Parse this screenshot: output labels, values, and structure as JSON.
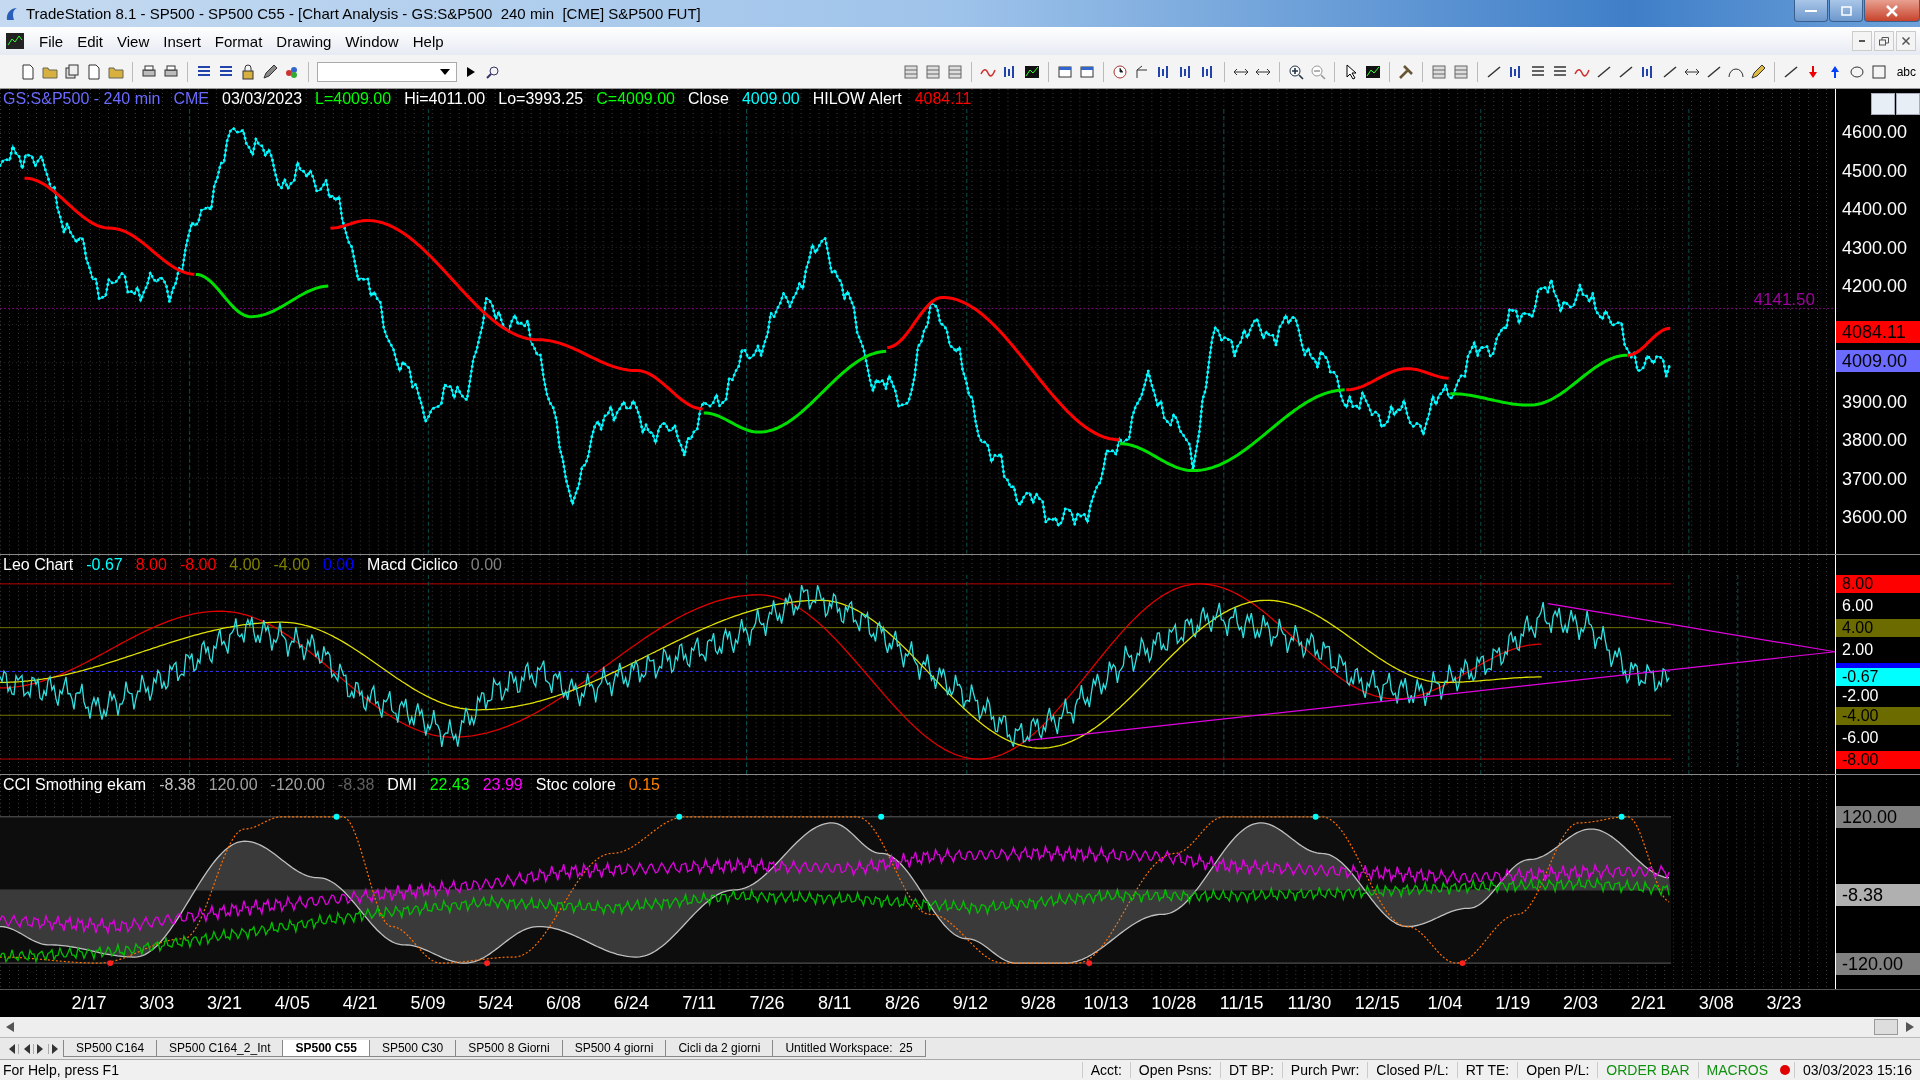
{
  "window": {
    "title": "TradeStation 8.1 - SP500 - SP500 C55 - [Chart Analysis - GS:S&P500  240 min  [CME] S&P500 FUT]"
  },
  "menu": [
    "File",
    "Edit",
    "View",
    "Insert",
    "Format",
    "Drawing",
    "Window",
    "Help"
  ],
  "toolbar": {
    "text_tool": "abc"
  },
  "price_panel": {
    "header": [
      {
        "text": "GS:S&P500 - 240 min",
        "color": "#6a6aff"
      },
      {
        "text": "CME",
        "color": "#6a6aff"
      },
      {
        "text": "03/03/2023",
        "color": "#ffffff"
      },
      {
        "text": "L=4009.00",
        "color": "#00ff00"
      },
      {
        "text": "Hi=4011.00",
        "color": "#ffffff"
      },
      {
        "text": "Lo=3993.25",
        "color": "#ffffff"
      },
      {
        "text": "C=4009.00",
        "color": "#00ff00"
      },
      {
        "text": "Close",
        "color": "#ffffff"
      },
      {
        "text": "4009.00",
        "color": "#00ffff"
      },
      {
        "text": "HILOW Alert",
        "color": "#ffffff"
      },
      {
        "text": "4084.11",
        "color": "#ff0000"
      }
    ],
    "level_label": "4141.50",
    "axis_ticks": [
      "4600.00",
      "4500.00",
      "4400.00",
      "4300.00",
      "4200.00",
      "3900.00",
      "3800.00",
      "3700.00",
      "3600.00"
    ],
    "markers": [
      {
        "text": "4084.11",
        "color": "#ff0000"
      },
      {
        "text": "4009.00",
        "color": "#6b6bff"
      }
    ]
  },
  "oscillator_panel": {
    "header": [
      {
        "text": "Leo Chart",
        "color": "#ffffff"
      },
      {
        "text": "-0.67",
        "color": "#00ffff"
      },
      {
        "text": "8.00",
        "color": "#ff0000"
      },
      {
        "text": "-8.00",
        "color": "#ff0000"
      },
      {
        "text": "4.00",
        "color": "#808000"
      },
      {
        "text": "-4.00",
        "color": "#808000"
      },
      {
        "text": "0.00",
        "color": "#0000ff"
      },
      {
        "text": "Macd Ciclico",
        "color": "#ffffff"
      },
      {
        "text": "0.00",
        "color": "#808080"
      }
    ],
    "axis_ticks": [
      "6.00",
      "2.00",
      "-2.00",
      "-6.00"
    ],
    "markers": [
      {
        "text": "8.00",
        "color": "#ff0000"
      },
      {
        "text": "4.00",
        "color": "#6b6b00"
      },
      {
        "text": "-0.67",
        "color": "#00ffff"
      },
      {
        "text": "-4.00",
        "color": "#6b6b00"
      },
      {
        "text": "-8.00",
        "color": "#ff0000"
      }
    ]
  },
  "cci_panel": {
    "header": [
      {
        "text": "CCI Smothing ekam",
        "color": "#ffffff"
      },
      {
        "text": "-8.38",
        "color": "#c0c0c0"
      },
      {
        "text": "120.00",
        "color": "#a0a0a0"
      },
      {
        "text": "-120.00",
        "color": "#a0a0a0"
      },
      {
        "text": "-8.38",
        "color": "#606060"
      },
      {
        "text": "DMI",
        "color": "#ffffff"
      },
      {
        "text": "22.43",
        "color": "#00ff00"
      },
      {
        "text": "23.99",
        "color": "#ff00ff"
      },
      {
        "text": "Stoc colore",
        "color": "#ffffff"
      },
      {
        "text": "0.15",
        "color": "#ff8000"
      }
    ],
    "markers": [
      {
        "text": "120.00",
        "color": "#808080"
      },
      {
        "text": "-8.38",
        "color": "#b0b0b0"
      },
      {
        "text": "-120.00",
        "color": "#808080"
      }
    ]
  },
  "date_axis": [
    "2/17",
    "3/03",
    "3/21",
    "4/05",
    "4/21",
    "5/09",
    "5/24",
    "6/08",
    "6/24",
    "7/11",
    "7/26",
    "8/11",
    "8/26",
    "9/12",
    "9/28",
    "10/13",
    "10/28",
    "11/15",
    "11/30",
    "12/15",
    "1/04",
    "1/19",
    "2/03",
    "2/21",
    "3/08",
    "3/23"
  ],
  "tabs": [
    {
      "label": "SP500 C164",
      "selected": false
    },
    {
      "label": "SP500 C164_2_Int",
      "selected": false
    },
    {
      "label": "SP500 C55",
      "selected": true
    },
    {
      "label": "SP500 C30",
      "selected": false
    },
    {
      "label": "SP500 8 Giorni",
      "selected": false
    },
    {
      "label": "SP500 4 giorni",
      "selected": false
    },
    {
      "label": "Cicli da 2 giorni",
      "selected": false
    },
    {
      "label": "Untitled Workspace:  25",
      "selected": false
    }
  ],
  "status_bar": {
    "help": "For Help, press F1",
    "fields": [
      "Acct:",
      "Open Psns:",
      "DT BP:",
      "Purch Pwr:",
      "Closed P/L:",
      "RT TE:",
      "Open P/L:"
    ],
    "order_bar": "ORDER BAR",
    "macros": "MACROS",
    "datetime": "03/03/2023 15:16"
  }
}
